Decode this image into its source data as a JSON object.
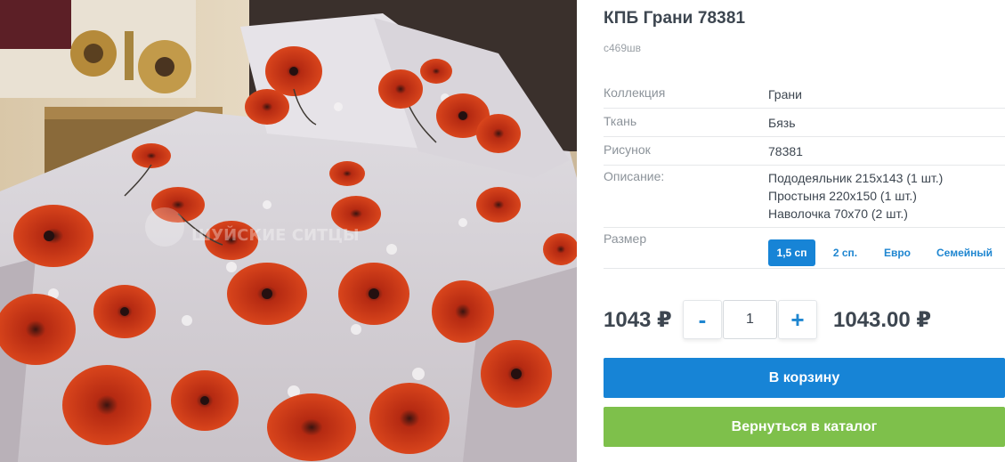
{
  "product": {
    "title": "КПБ Грани 78381",
    "sku": "с469шв",
    "image_watermark": "ШУЙСКИЕ СИТЦЫ"
  },
  "properties": [
    {
      "label": "Коллекция",
      "value": "Грани"
    },
    {
      "label": "Ткань",
      "value": "Бязь"
    },
    {
      "label": "Рисунок",
      "value": "78381"
    },
    {
      "label": "Описание:",
      "lines": [
        "Пододеяльник 215x143 (1 шт.)",
        "Простыня 220x150 (1 шт.)",
        "Наволочка 70x70 (2 шт.)"
      ]
    }
  ],
  "size": {
    "label": "Размер",
    "options": [
      "1,5 сп",
      "2 сп.",
      "Евро",
      "Семейный"
    ],
    "selected": "1,5 сп"
  },
  "purchase": {
    "unit_price": "1043 ₽",
    "quantity": "1",
    "minus_label": "-",
    "plus_label": "+",
    "total": "1043.00 ₽"
  },
  "actions": {
    "add_to_cart": "В корзину",
    "back_to_catalog": "Вернуться в каталог"
  },
  "colors": {
    "accent_blue": "#1784d6",
    "accent_green": "#7ec04b",
    "text_dark": "#3d4650",
    "text_muted": "#8c939a"
  }
}
